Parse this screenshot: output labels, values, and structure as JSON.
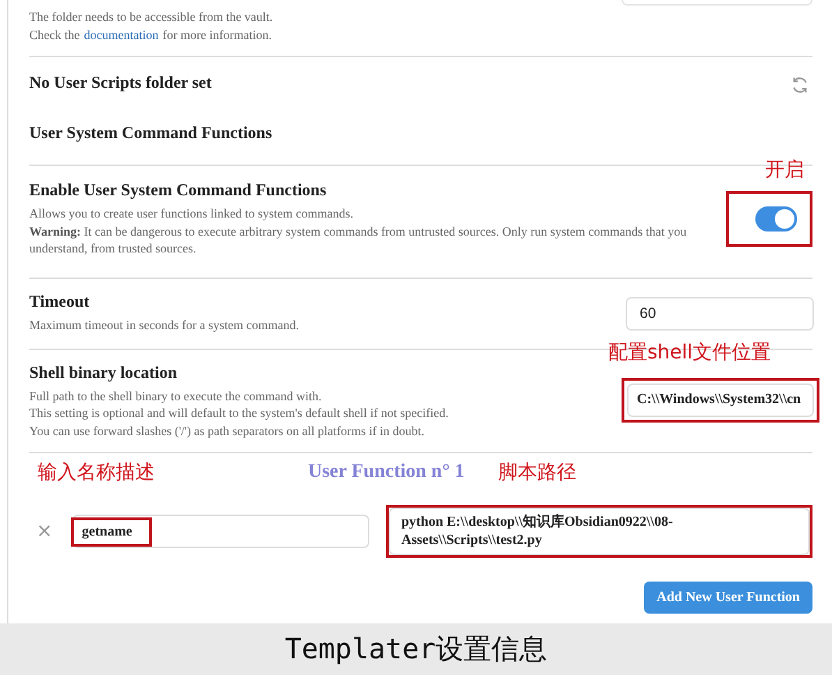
{
  "folder_note": {
    "line_1": "The folder needs to be accessible from the vault.",
    "line_2_before": "Check the",
    "link": "documentation",
    "line_2_after": "for more information."
  },
  "settings": [
    {
      "kind": "status",
      "name": "No User Scripts folder set"
    },
    {
      "kind": "heading",
      "name": "User System Command Functions"
    },
    {
      "kind": "toggle",
      "name": "Enable User System Command Functions",
      "description": [
        "Allows you to create user functions linked to system commands.",
        "**Warning:** It can be dangerous to execute arbitrary system commands from untrusted sources. Only run system commands that you understand, from trusted sources."
      ],
      "on": true,
      "highlighted": true,
      "annotation": "开启"
    },
    {
      "kind": "text",
      "name": "Timeout",
      "description": [
        "Maximum timeout in seconds for a system command."
      ],
      "value": "60",
      "highlighted": false
    },
    {
      "kind": "text",
      "name": "Shell binary location",
      "description": [
        "Full path to the shell binary to execute the command with.",
        "This setting is optional and will default to the system's default shell if not specified.",
        "You can use forward slashes ('/') as path separators on all platforms if in doubt."
      ],
      "value": "C:\\\\Windows\\\\System32\\\\cn",
      "highlighted": true,
      "annotation": "配置shell文件位置"
    }
  ],
  "user_function": {
    "name_annotation": "输入名称描述",
    "title": "User Function n° 1",
    "script_annotation": "脚本路径",
    "remove": "×",
    "name": {
      "value": "getname",
      "highlighted": true
    },
    "command": {
      "value": "python E:\\\\desktop\\\\知识库Obsidian0922\\\\08-Assets\\\\Scripts\\\\test2.py",
      "highlighted": true
    }
  },
  "add_button": "Add New User Function",
  "caption": "Templater设置信息"
}
